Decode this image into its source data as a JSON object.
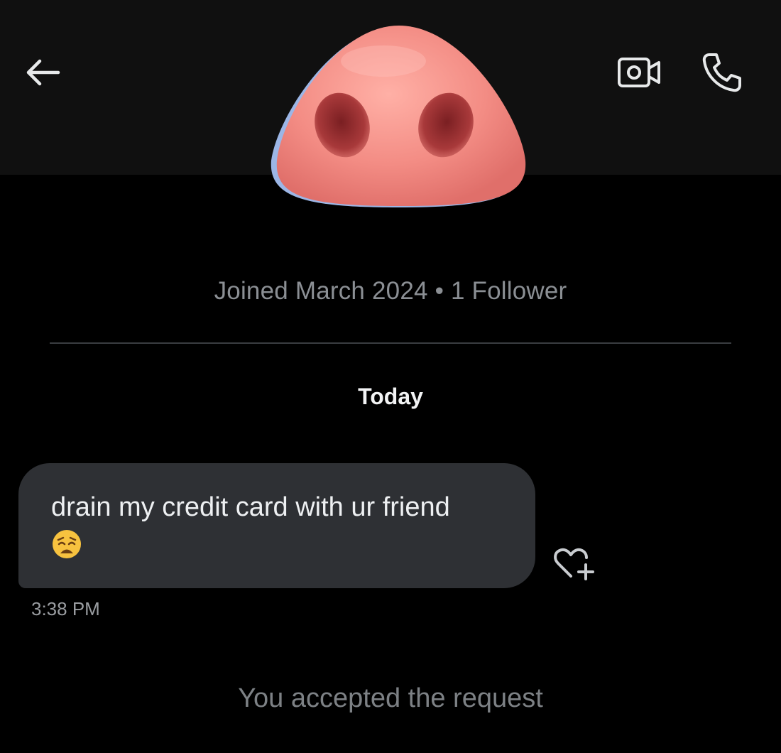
{
  "header": {
    "back_icon": "arrow-left-icon",
    "video_icon": "video-camera-icon",
    "call_icon": "phone-icon",
    "avatar_icon": "pig-nose-emoji"
  },
  "profile": {
    "meta": "Joined March 2024 • 1 Follower"
  },
  "conversation": {
    "date_label": "Today",
    "messages": [
      {
        "text": "drain my credit card with ur friend",
        "emoji": "weary-face-emoji",
        "time": "3:38 PM",
        "reaction_icon": "heart-plus-icon"
      }
    ],
    "status": "You accepted the request"
  },
  "colors": {
    "background": "#000000",
    "header_background": "#101010",
    "bubble": "#2e3034",
    "avatar_pink": "#f08f88"
  }
}
